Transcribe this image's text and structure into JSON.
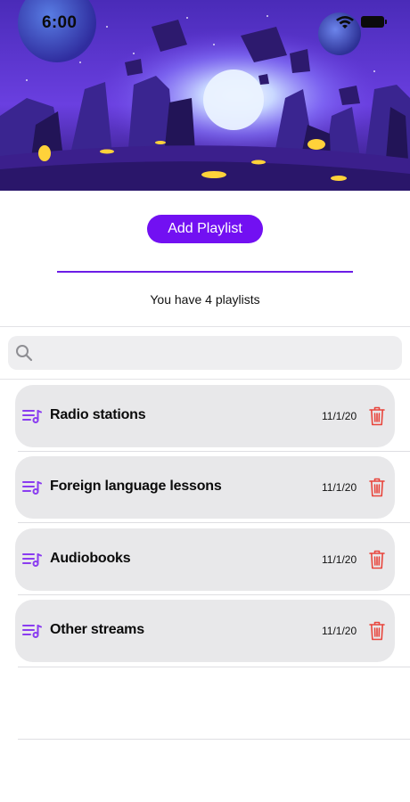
{
  "status_bar": {
    "time": "6:00"
  },
  "actions": {
    "add_playlist_label": "Add Playlist"
  },
  "summary": {
    "count_text": "You have 4 playlists"
  },
  "search": {
    "value": "",
    "placeholder": ""
  },
  "playlists": [
    {
      "title": "Radio stations",
      "date": "11/1/20",
      "icon": "playlist-icon",
      "delete_icon": "trash-icon"
    },
    {
      "title": "Foreign language lessons",
      "date": "11/1/20",
      "icon": "playlist-icon",
      "delete_icon": "trash-icon"
    },
    {
      "title": "Audiobooks",
      "date": "11/1/20",
      "icon": "playlist-icon",
      "delete_icon": "trash-icon"
    },
    {
      "title": "Other streams",
      "date": "11/1/20",
      "icon": "playlist-icon",
      "delete_icon": "trash-icon"
    }
  ],
  "colors": {
    "accent": "#7210f2",
    "divider_accent": "#6c1de6",
    "row_background": "#e8e8ea",
    "delete": "#e8453c",
    "playlist_icon": "#8a3cf0"
  }
}
